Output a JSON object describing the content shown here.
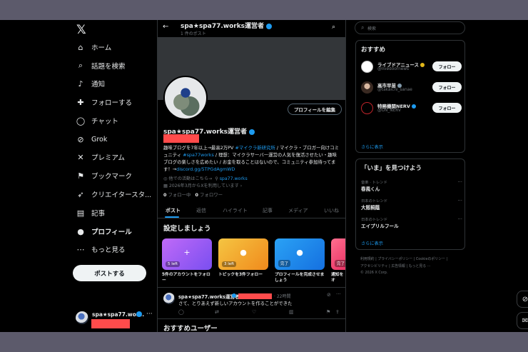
{
  "sidebar": {
    "logo": "𝕏",
    "items": [
      {
        "label": "ホーム",
        "icon": "home-icon",
        "glyph": "⌂"
      },
      {
        "label": "話題を検索",
        "icon": "search-icon",
        "glyph": "⌕"
      },
      {
        "label": "通知",
        "icon": "bell-icon",
        "glyph": "♪"
      },
      {
        "label": "フォローする",
        "icon": "add-person-icon",
        "glyph": "✚"
      },
      {
        "label": "チャット",
        "icon": "chat-icon",
        "glyph": "◯"
      },
      {
        "label": "Grok",
        "icon": "grok-icon",
        "glyph": "⊘"
      },
      {
        "label": "プレミアム",
        "icon": "x-premium-icon",
        "glyph": "✕"
      },
      {
        "label": "ブックマーク",
        "icon": "bookmark-icon",
        "glyph": "⚑"
      },
      {
        "label": "クリエイタースタ...",
        "icon": "rocket-icon",
        "glyph": "➶"
      },
      {
        "label": "記事",
        "icon": "article-icon",
        "glyph": "▤"
      },
      {
        "label": "プロフィール",
        "icon": "profile-icon",
        "glyph": "●"
      },
      {
        "label": "もっと見る",
        "icon": "more-circle-icon",
        "glyph": "⋯"
      }
    ],
    "post_button": "ポストする",
    "account": {
      "name": "spa★spa77.wor...",
      "more": "···"
    }
  },
  "header": {
    "back": "←",
    "title": "spa★spa77.works運営者",
    "subtitle": "1 件のポスト",
    "search": "⌕"
  },
  "profile": {
    "edit_button": "プロフィールを編集",
    "name": "spa★spa77.works運営者",
    "bio_lines": [
      {
        "text": "趣味ブログを7年以上→最高2万PV ",
        "link": "#マイクラ新研究所",
        "tail": " / マイクラ・ブロガー向けコミ"
      },
      {
        "text": "ュニティ ",
        "link": "#spa77works",
        "tail": " / 理想：マイクラサーバー運営の人気を復活させたい・趣味"
      },
      {
        "text": "ブログの楽しさを広めたい / お金を取ることはないので、コミュニティ参加待ってま",
        "link": "",
        "tail": ""
      },
      {
        "text": "す！→",
        "link": "discord.gg/5TPGdAgmWD",
        "tail": ""
      }
    ],
    "meta_line1_a": "◎ 他での活動はこちら→",
    "meta_line1_link": "spa77.works",
    "meta_line1_link_prefix": "⚲ ",
    "meta_line2": "▦ 2026年3月からXを利用しています ›",
    "following_count": "0",
    "following_label": " フォロー中",
    "followers_count": "0",
    "followers_label": " フォロワー"
  },
  "tabs": [
    "ポスト",
    "返信",
    "ハイライト",
    "記事",
    "メディア",
    "いいね"
  ],
  "setup": {
    "title": "設定しましょう",
    "cards": [
      {
        "badge": "5 left",
        "label": "5件のアカウントをフォロ ー",
        "color": "#a74ff5",
        "glyph": "+"
      },
      {
        "badge": "3 left",
        "label": "トピックを3件フォロー",
        "color": "#f0a020",
        "glyph": "●"
      },
      {
        "badge": "完了",
        "label": "プロフィールを完成させましょう",
        "color": "#1d8bf0",
        "glyph": "●"
      },
      {
        "badge": "完了",
        "label": "通知をオ",
        "color": "#f03c6e",
        "glyph": ""
      }
    ]
  },
  "post": {
    "name": "spa★spa77.works運営者",
    "time": "· 22時間",
    "text": "さて、とりあえず新しいアカウントを作ることができた",
    "grok": "⊘",
    "more": "···",
    "actions": [
      "◯",
      "⇄",
      "♡",
      "▥",
      "⚑",
      "⇪"
    ]
  },
  "recommended_users_title": "おすすめユーザー",
  "right": {
    "search_placeholder": "検索",
    "recommend": {
      "title": "おすすめ",
      "users": [
        {
          "name": "ライブドアニュース",
          "handle": "@livedoornews",
          "badge_color": "#e2b719",
          "avatar_color": "#ffffff",
          "button": "フォロー"
        },
        {
          "name": "高市早苗",
          "handle": "@takaichi_sanae",
          "badge_color": "#829aab",
          "avatar_color": "#6b4a3a",
          "button": "フォロー"
        },
        {
          "name": "特務機関NERV",
          "handle": "@UN_NERV",
          "badge_color": "#1d9bf0",
          "avatar_color": "#c0242a",
          "button": "フォロー"
        }
      ],
      "show_more": "さらに表示"
    },
    "trends": {
      "title": "「いま」を見つけよう",
      "items": [
        {
          "context": "音楽 · トレンド",
          "name": "春風くん"
        },
        {
          "context": "日本のトレンド",
          "name": "大阪桐蔭"
        },
        {
          "context": "日本のトレンド",
          "name": "エイプリルフール"
        }
      ],
      "show_more": "さらに表示"
    },
    "footer": [
      "利用規約  |  プライバシーポリシー  |  Cookieのポリシー  |",
      "アクセシビリティ  |  広告情報  |  もっと見る ···",
      "© 2026 X Corp."
    ]
  },
  "floating": {
    "grok": "⊘",
    "messages": "✉"
  }
}
